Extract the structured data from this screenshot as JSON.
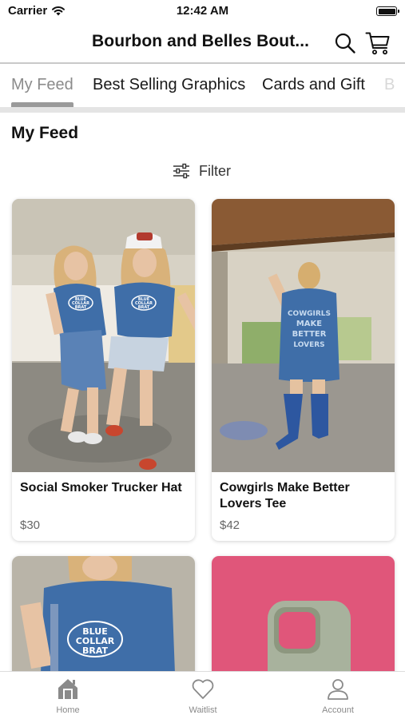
{
  "status_bar": {
    "carrier": "Carrier",
    "time": "12:42 AM"
  },
  "header": {
    "title": "Bourbon and Belles Bout...",
    "search_icon": "search-icon",
    "cart_icon": "cart-icon"
  },
  "tabs": [
    {
      "label": "My Feed",
      "active": true
    },
    {
      "label": "Best Selling Graphics",
      "active": false
    },
    {
      "label": "Cards and Gift",
      "active": false
    },
    {
      "label": "B",
      "active": false
    }
  ],
  "section_title": "My Feed",
  "filter": {
    "label": "Filter",
    "icon": "sliders-icon"
  },
  "products": [
    {
      "name": "Social Smoker Trucker Hat",
      "price": "$30",
      "image_text": [
        "BLUE",
        "COLLAR",
        "BRAT"
      ]
    },
    {
      "name": "Cowgirls Make Better Lovers Tee",
      "price": "$42",
      "image_text": [
        "COWGIRLS",
        "MAKE",
        "BETTER",
        "LOVERS"
      ]
    },
    {
      "name": "",
      "price": "",
      "image_text": [
        "BLUE",
        "COLLAR",
        "BRAT"
      ]
    },
    {
      "name": "",
      "price": "",
      "image_text": []
    }
  ],
  "bottom_nav": [
    {
      "label": "Home",
      "icon": "home-icon"
    },
    {
      "label": "Waitlist",
      "icon": "heart-icon"
    },
    {
      "label": "Account",
      "icon": "person-icon"
    }
  ],
  "colors": {
    "shirt_blue": "#3f6ea8",
    "active_tab": "#8b8b8b",
    "pink_bg": "#e0567a"
  }
}
